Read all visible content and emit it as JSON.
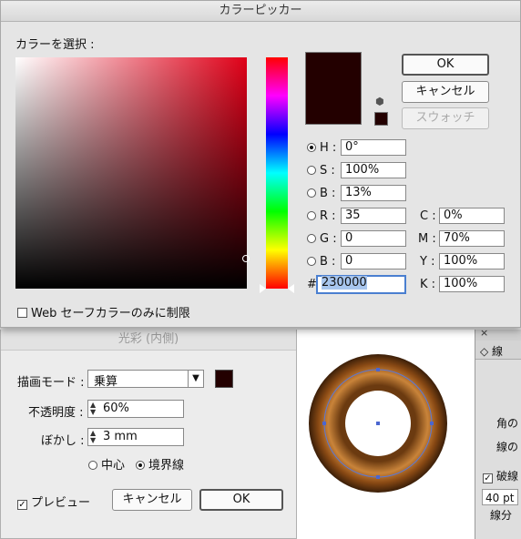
{
  "picker": {
    "title": "カラーピッカー",
    "select_label": "カラーを選択 :",
    "buttons": {
      "ok": "OK",
      "cancel": "キャンセル",
      "swatch": "スウォッチ"
    },
    "hsb": [
      {
        "key": "H",
        "value": "0°",
        "checked": true
      },
      {
        "key": "S",
        "value": "100%",
        "checked": false
      },
      {
        "key": "B",
        "value": "13%",
        "checked": false
      }
    ],
    "rgb": [
      {
        "key": "R",
        "value": "35"
      },
      {
        "key": "G",
        "value": "0"
      },
      {
        "key": "B",
        "value": "0"
      }
    ],
    "cmyk": [
      {
        "key": "C",
        "value": "0%"
      },
      {
        "key": "M",
        "value": "70%"
      },
      {
        "key": "Y",
        "value": "100%"
      },
      {
        "key": "K",
        "value": "100%"
      }
    ],
    "hex_label": "#",
    "hex_value": "230000",
    "web_only_label": "Web セーフカラーのみに制限",
    "colors": {
      "current": "#230000",
      "field_hue": "#e00018"
    }
  },
  "glow": {
    "title": "光彩 (内側)",
    "mode_label": "描画モード :",
    "mode_value": "乗算",
    "opacity_label": "不透明度 :",
    "opacity_value": "60%",
    "blur_label": "ぼかし :",
    "blur_value": "3 mm",
    "center_label": "中心",
    "edge_label": "境界線",
    "preview_label": "プレビュー",
    "cancel_label": "キャンセル",
    "ok_label": "OK",
    "swatch_color": "#230000"
  },
  "rightpanel": {
    "tab_label": "線",
    "corner_label": "角の",
    "cap_label": "線の",
    "dashed_label": "破線",
    "dash_value": "40 pt",
    "segment_label": "線分"
  }
}
